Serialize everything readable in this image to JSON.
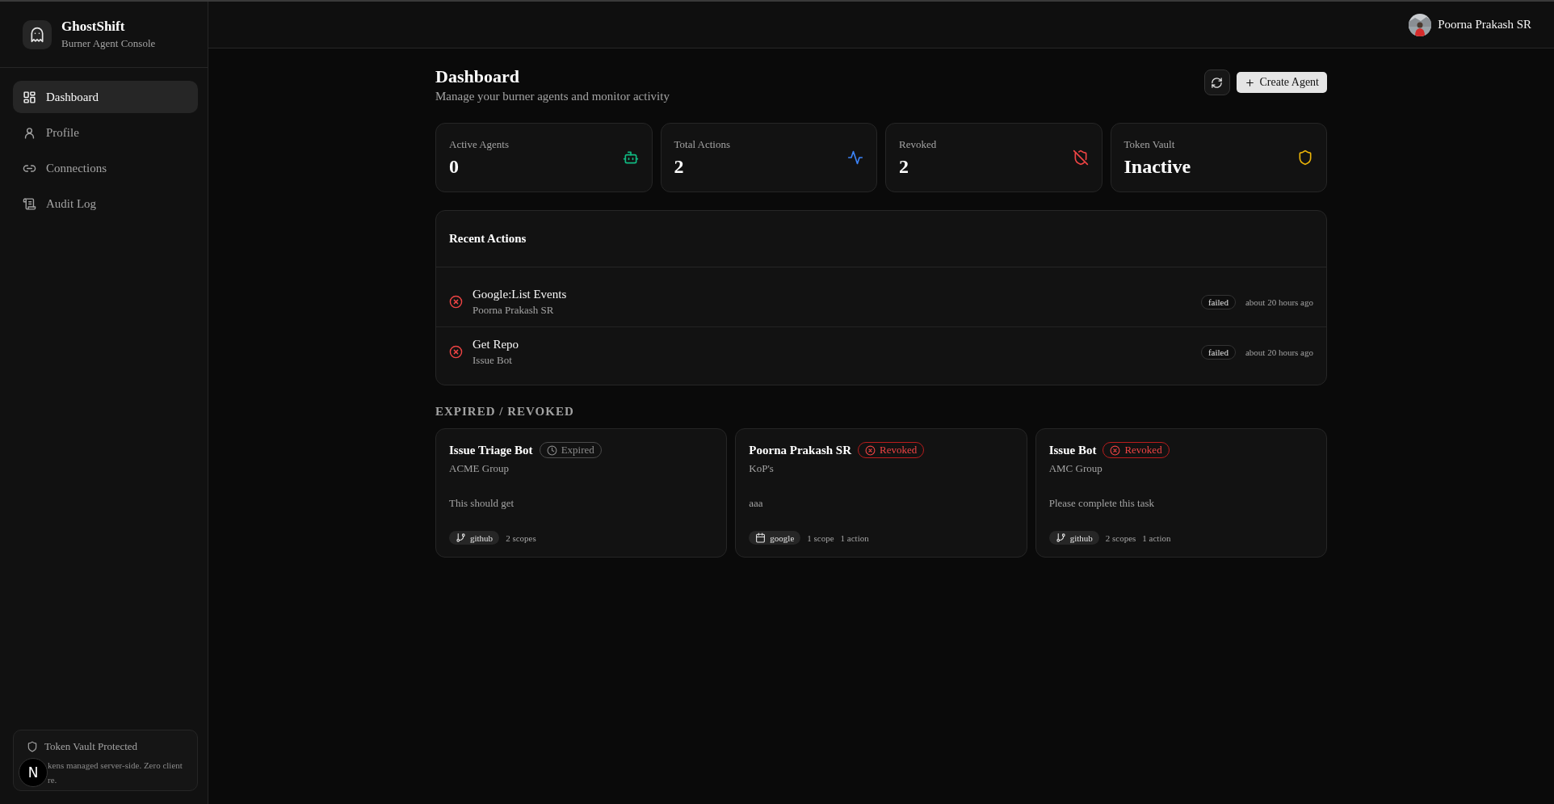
{
  "brand": {
    "name": "GhostShift",
    "tagline": "Burner Agent Console"
  },
  "nav": [
    {
      "label": "Dashboard",
      "selected": true
    },
    {
      "label": "Profile",
      "selected": false
    },
    {
      "label": "Connections",
      "selected": false
    },
    {
      "label": "Audit Log",
      "selected": false
    }
  ],
  "vault_note": {
    "title": "Token Vault Protected",
    "lines": [
      "kens managed server-side. Zero client",
      "re."
    ]
  },
  "dev_badge": {
    "label": "N"
  },
  "user": {
    "name": "Poorna Prakash SR"
  },
  "page": {
    "title": "Dashboard",
    "subtitle": "Manage your burner agents and monitor activity",
    "create_button": "Create Agent"
  },
  "stats": [
    {
      "label": "Active Agents",
      "value": "0",
      "color": "#10b981"
    },
    {
      "label": "Total Actions",
      "value": "2",
      "color": "#3b82f6"
    },
    {
      "label": "Revoked",
      "value": "2",
      "color": "#ef4444"
    },
    {
      "label": "Token Vault",
      "value": "Inactive",
      "color": "#eab308"
    }
  ],
  "recent_actions": {
    "title": "Recent Actions",
    "rows": [
      {
        "name": "Google:List Events",
        "agent": "Poorna Prakash SR",
        "kind": "failed",
        "status": "failed",
        "time": "about 20 hours ago"
      },
      {
        "name": "Get Repo",
        "agent": "Issue Bot",
        "kind": "failed",
        "status": "failed",
        "time": "about 20 hours ago"
      }
    ]
  },
  "expired_section": {
    "title": "EXPIRED / REVOKED",
    "agents": [
      {
        "name": "Issue Triage Bot",
        "kind": "expired",
        "status": "Expired",
        "group": "ACME Group",
        "task": "This should get",
        "provider": "github",
        "meta": [
          "2 scopes"
        ]
      },
      {
        "name": "Poorna Prakash SR",
        "kind": "revoked",
        "status": "Revoked",
        "group": "KoP's",
        "task": "aaa",
        "provider": "google",
        "meta": [
          "1 scope",
          "1 action"
        ]
      },
      {
        "name": "Issue Bot",
        "kind": "revoked",
        "status": "Revoked",
        "group": "AMC Group",
        "task": "Please complete this task",
        "provider": "github",
        "meta": [
          "2 scopes",
          "1 action"
        ]
      }
    ]
  }
}
